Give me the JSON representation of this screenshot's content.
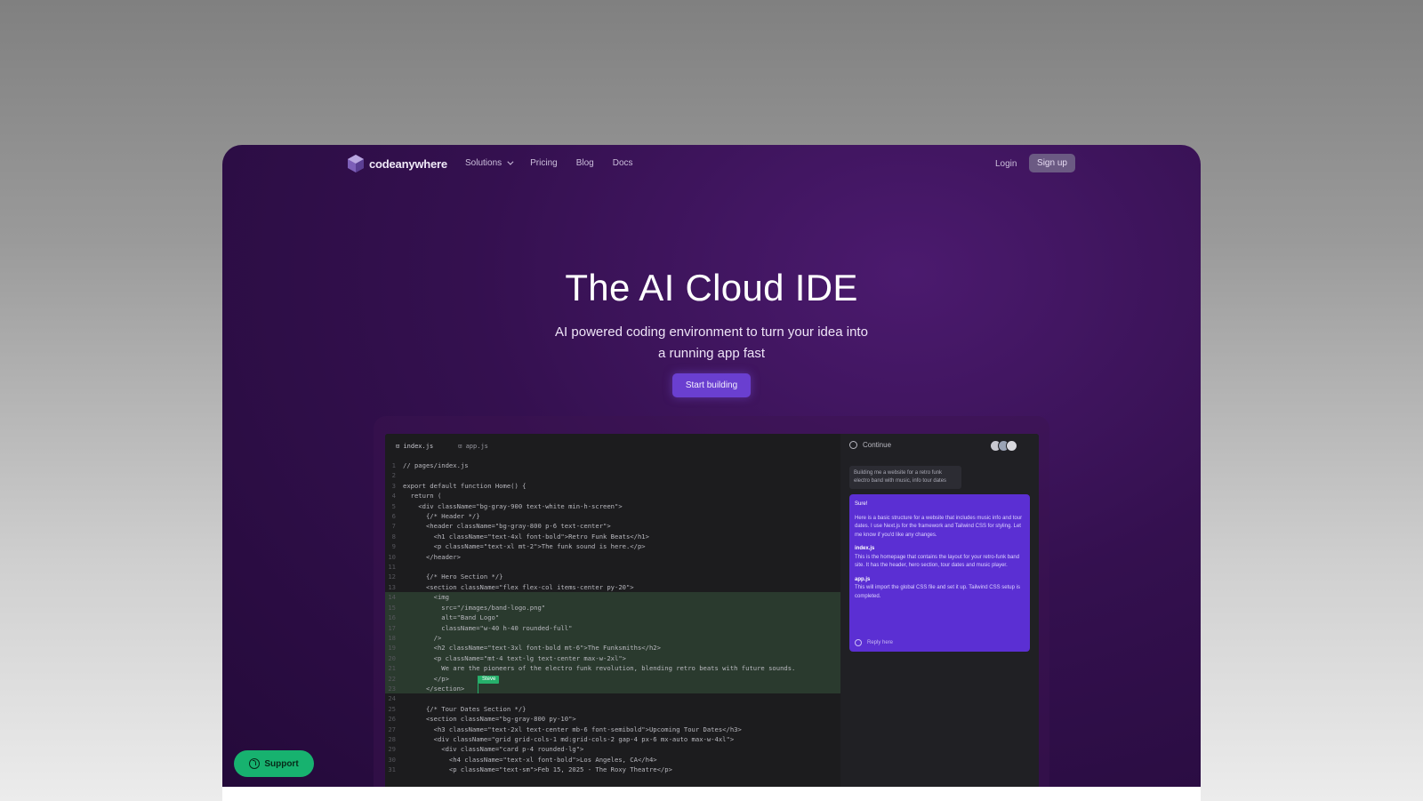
{
  "nav": {
    "brand": "codeanywhere",
    "links": [
      {
        "label": "Solutions",
        "has_dropdown": true
      },
      {
        "label": "Pricing"
      },
      {
        "label": "Blog"
      },
      {
        "label": "Docs"
      }
    ],
    "login_label": "Login",
    "signup_label": "Sign up"
  },
  "hero": {
    "title": "The AI Cloud IDE",
    "subtitle": "AI powered coding environment to turn your idea into a running app fast",
    "cta_label": "Start building"
  },
  "ide": {
    "tabs": [
      "index.js",
      "app.js"
    ],
    "code_lines": [
      "// pages/index.js",
      "",
      "export default function Home() {",
      "  return (",
      "    <div className=\"bg-gray-900 text-white min-h-screen\">",
      "      {/* Header */}",
      "      <header className=\"bg-gray-800 p-6 text-center\">",
      "        <h1 className=\"text-4xl font-bold\">Retro Funk Beats</h1>",
      "        <p className=\"text-xl mt-2\">The funk sound is here.</p>",
      "      </header>",
      "",
      "      {/* Hero Section */}",
      "      <section className=\"flex flex-col items-center py-20\">",
      "        <img",
      "          src=\"/images/band-logo.png\"",
      "          alt=\"Band Logo\"",
      "          className=\"w-40 h-40 rounded-full\"",
      "        />",
      "        <h2 className=\"text-3xl font-bold mt-6\">The Funksmiths</h2>",
      "        <p className=\"mt-4 text-lg text-center max-w-2xl\">",
      "          We are the pioneers of the electro funk revolution, blending retro beats with future sounds.",
      "        </p>",
      "      </section>",
      "",
      "      {/* Tour Dates Section */}",
      "      <section className=\"bg-gray-800 py-10\">",
      "        <h3 className=\"text-2xl text-center mb-6 font-semibold\">Upcoming Tour Dates</h3>",
      "        <div className=\"grid grid-cols-1 md:grid-cols-2 gap-4 px-6 mx-auto max-w-4xl\">",
      "          <div className=\"card p-4 rounded-lg\">",
      "            <h4 className=\"text-xl font-bold\">Los Angeles, CA</h4>",
      "            <p className=\"text-sm\">Feb 15, 2025 - The Roxy Theatre</p>"
    ],
    "highlight_range": [
      14,
      23
    ],
    "cursor_label": "Steve",
    "chat": {
      "title": "Continue",
      "user_message": "Building me a website for a retro funk electro band with music, info tour dates",
      "ai_response": {
        "intro_heading": "Sure!",
        "intro": "Here is a basic structure for a website that includes music info and tour dates. I use Next.js for the framework and Tailwind CSS for styling. Let me know if you'd like any changes.",
        "sections": [
          {
            "heading": "index.js",
            "text": "This is the homepage that contains the layout for your retro-funk band site. It has the header, hero section, tour dates and music player."
          },
          {
            "heading": "app.js",
            "text": "This will import the global CSS file and set it up. Tailwind CSS setup is completed."
          }
        ],
        "footer_placeholder": "Reply here"
      }
    }
  },
  "support_label": "Support"
}
